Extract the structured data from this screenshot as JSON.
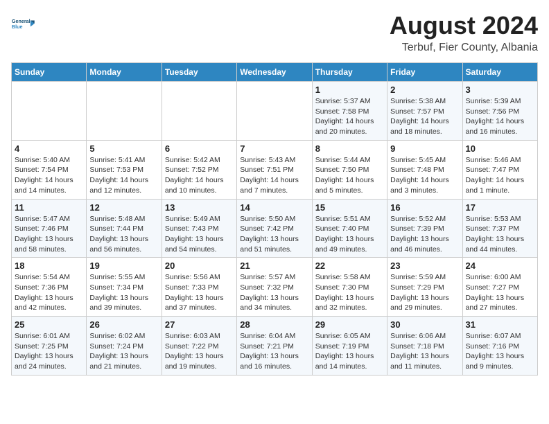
{
  "header": {
    "logo_line1": "General",
    "logo_line2": "Blue",
    "title": "August 2024",
    "subtitle": "Terbuf, Fier County, Albania"
  },
  "days_of_week": [
    "Sunday",
    "Monday",
    "Tuesday",
    "Wednesday",
    "Thursday",
    "Friday",
    "Saturday"
  ],
  "weeks": [
    [
      {
        "day": "",
        "info": ""
      },
      {
        "day": "",
        "info": ""
      },
      {
        "day": "",
        "info": ""
      },
      {
        "day": "",
        "info": ""
      },
      {
        "day": "1",
        "info": "Sunrise: 5:37 AM\nSunset: 7:58 PM\nDaylight: 14 hours\nand 20 minutes."
      },
      {
        "day": "2",
        "info": "Sunrise: 5:38 AM\nSunset: 7:57 PM\nDaylight: 14 hours\nand 18 minutes."
      },
      {
        "day": "3",
        "info": "Sunrise: 5:39 AM\nSunset: 7:56 PM\nDaylight: 14 hours\nand 16 minutes."
      }
    ],
    [
      {
        "day": "4",
        "info": "Sunrise: 5:40 AM\nSunset: 7:54 PM\nDaylight: 14 hours\nand 14 minutes."
      },
      {
        "day": "5",
        "info": "Sunrise: 5:41 AM\nSunset: 7:53 PM\nDaylight: 14 hours\nand 12 minutes."
      },
      {
        "day": "6",
        "info": "Sunrise: 5:42 AM\nSunset: 7:52 PM\nDaylight: 14 hours\nand 10 minutes."
      },
      {
        "day": "7",
        "info": "Sunrise: 5:43 AM\nSunset: 7:51 PM\nDaylight: 14 hours\nand 7 minutes."
      },
      {
        "day": "8",
        "info": "Sunrise: 5:44 AM\nSunset: 7:50 PM\nDaylight: 14 hours\nand 5 minutes."
      },
      {
        "day": "9",
        "info": "Sunrise: 5:45 AM\nSunset: 7:48 PM\nDaylight: 14 hours\nand 3 minutes."
      },
      {
        "day": "10",
        "info": "Sunrise: 5:46 AM\nSunset: 7:47 PM\nDaylight: 14 hours\nand 1 minute."
      }
    ],
    [
      {
        "day": "11",
        "info": "Sunrise: 5:47 AM\nSunset: 7:46 PM\nDaylight: 13 hours\nand 58 minutes."
      },
      {
        "day": "12",
        "info": "Sunrise: 5:48 AM\nSunset: 7:44 PM\nDaylight: 13 hours\nand 56 minutes."
      },
      {
        "day": "13",
        "info": "Sunrise: 5:49 AM\nSunset: 7:43 PM\nDaylight: 13 hours\nand 54 minutes."
      },
      {
        "day": "14",
        "info": "Sunrise: 5:50 AM\nSunset: 7:42 PM\nDaylight: 13 hours\nand 51 minutes."
      },
      {
        "day": "15",
        "info": "Sunrise: 5:51 AM\nSunset: 7:40 PM\nDaylight: 13 hours\nand 49 minutes."
      },
      {
        "day": "16",
        "info": "Sunrise: 5:52 AM\nSunset: 7:39 PM\nDaylight: 13 hours\nand 46 minutes."
      },
      {
        "day": "17",
        "info": "Sunrise: 5:53 AM\nSunset: 7:37 PM\nDaylight: 13 hours\nand 44 minutes."
      }
    ],
    [
      {
        "day": "18",
        "info": "Sunrise: 5:54 AM\nSunset: 7:36 PM\nDaylight: 13 hours\nand 42 minutes."
      },
      {
        "day": "19",
        "info": "Sunrise: 5:55 AM\nSunset: 7:34 PM\nDaylight: 13 hours\nand 39 minutes."
      },
      {
        "day": "20",
        "info": "Sunrise: 5:56 AM\nSunset: 7:33 PM\nDaylight: 13 hours\nand 37 minutes."
      },
      {
        "day": "21",
        "info": "Sunrise: 5:57 AM\nSunset: 7:32 PM\nDaylight: 13 hours\nand 34 minutes."
      },
      {
        "day": "22",
        "info": "Sunrise: 5:58 AM\nSunset: 7:30 PM\nDaylight: 13 hours\nand 32 minutes."
      },
      {
        "day": "23",
        "info": "Sunrise: 5:59 AM\nSunset: 7:29 PM\nDaylight: 13 hours\nand 29 minutes."
      },
      {
        "day": "24",
        "info": "Sunrise: 6:00 AM\nSunset: 7:27 PM\nDaylight: 13 hours\nand 27 minutes."
      }
    ],
    [
      {
        "day": "25",
        "info": "Sunrise: 6:01 AM\nSunset: 7:25 PM\nDaylight: 13 hours\nand 24 minutes."
      },
      {
        "day": "26",
        "info": "Sunrise: 6:02 AM\nSunset: 7:24 PM\nDaylight: 13 hours\nand 21 minutes."
      },
      {
        "day": "27",
        "info": "Sunrise: 6:03 AM\nSunset: 7:22 PM\nDaylight: 13 hours\nand 19 minutes."
      },
      {
        "day": "28",
        "info": "Sunrise: 6:04 AM\nSunset: 7:21 PM\nDaylight: 13 hours\nand 16 minutes."
      },
      {
        "day": "29",
        "info": "Sunrise: 6:05 AM\nSunset: 7:19 PM\nDaylight: 13 hours\nand 14 minutes."
      },
      {
        "day": "30",
        "info": "Sunrise: 6:06 AM\nSunset: 7:18 PM\nDaylight: 13 hours\nand 11 minutes."
      },
      {
        "day": "31",
        "info": "Sunrise: 6:07 AM\nSunset: 7:16 PM\nDaylight: 13 hours\nand 9 minutes."
      }
    ]
  ]
}
